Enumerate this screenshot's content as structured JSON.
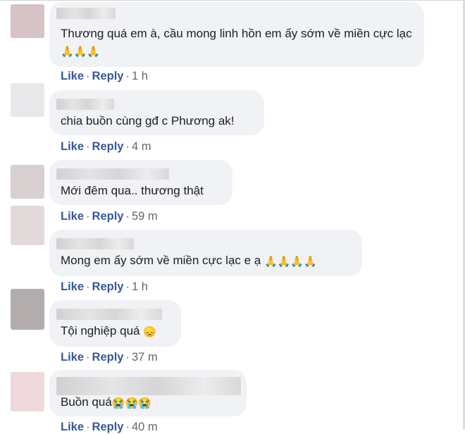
{
  "comments": [
    {
      "text": "Thương quá em à, cầu mong linh hồn em ấy sớm về miền cực lạc",
      "emojis": "🙏🙏🙏",
      "like_label": "Like",
      "reply_label": "Reply",
      "time": "1 h",
      "avatar_color": "#d6c3c6"
    },
    {
      "text": "chia buồn cùng gđ c Phương ak!",
      "emojis": "",
      "like_label": "Like",
      "reply_label": "Reply",
      "time": "4 m",
      "avatar_color": "#e9e8ea"
    },
    {
      "text": "Mới đêm qua.. thương thật",
      "emojis": "",
      "like_label": "Like",
      "reply_label": "Reply",
      "time": "59 m",
      "avatar_color": "#d8cfd0"
    },
    {
      "text": "Mong em ấy sớm về miền cực lạc e ạ",
      "emojis": "🙏🙏🙏🙏",
      "like_label": "Like",
      "reply_label": "Reply",
      "time": "1 h",
      "avatar_color": "#e2dada"
    },
    {
      "text": "Tội nghiệp quá",
      "emojis": "😞",
      "like_label": "Like",
      "reply_label": "Reply",
      "time": "37 m",
      "avatar_color": "#b3acad"
    },
    {
      "text": "Buồn quá",
      "emojis": "😭😭😭",
      "like_label": "Like",
      "reply_label": "Reply",
      "time": "40 m",
      "avatar_color": "#efd9dd"
    }
  ],
  "separator": "·"
}
